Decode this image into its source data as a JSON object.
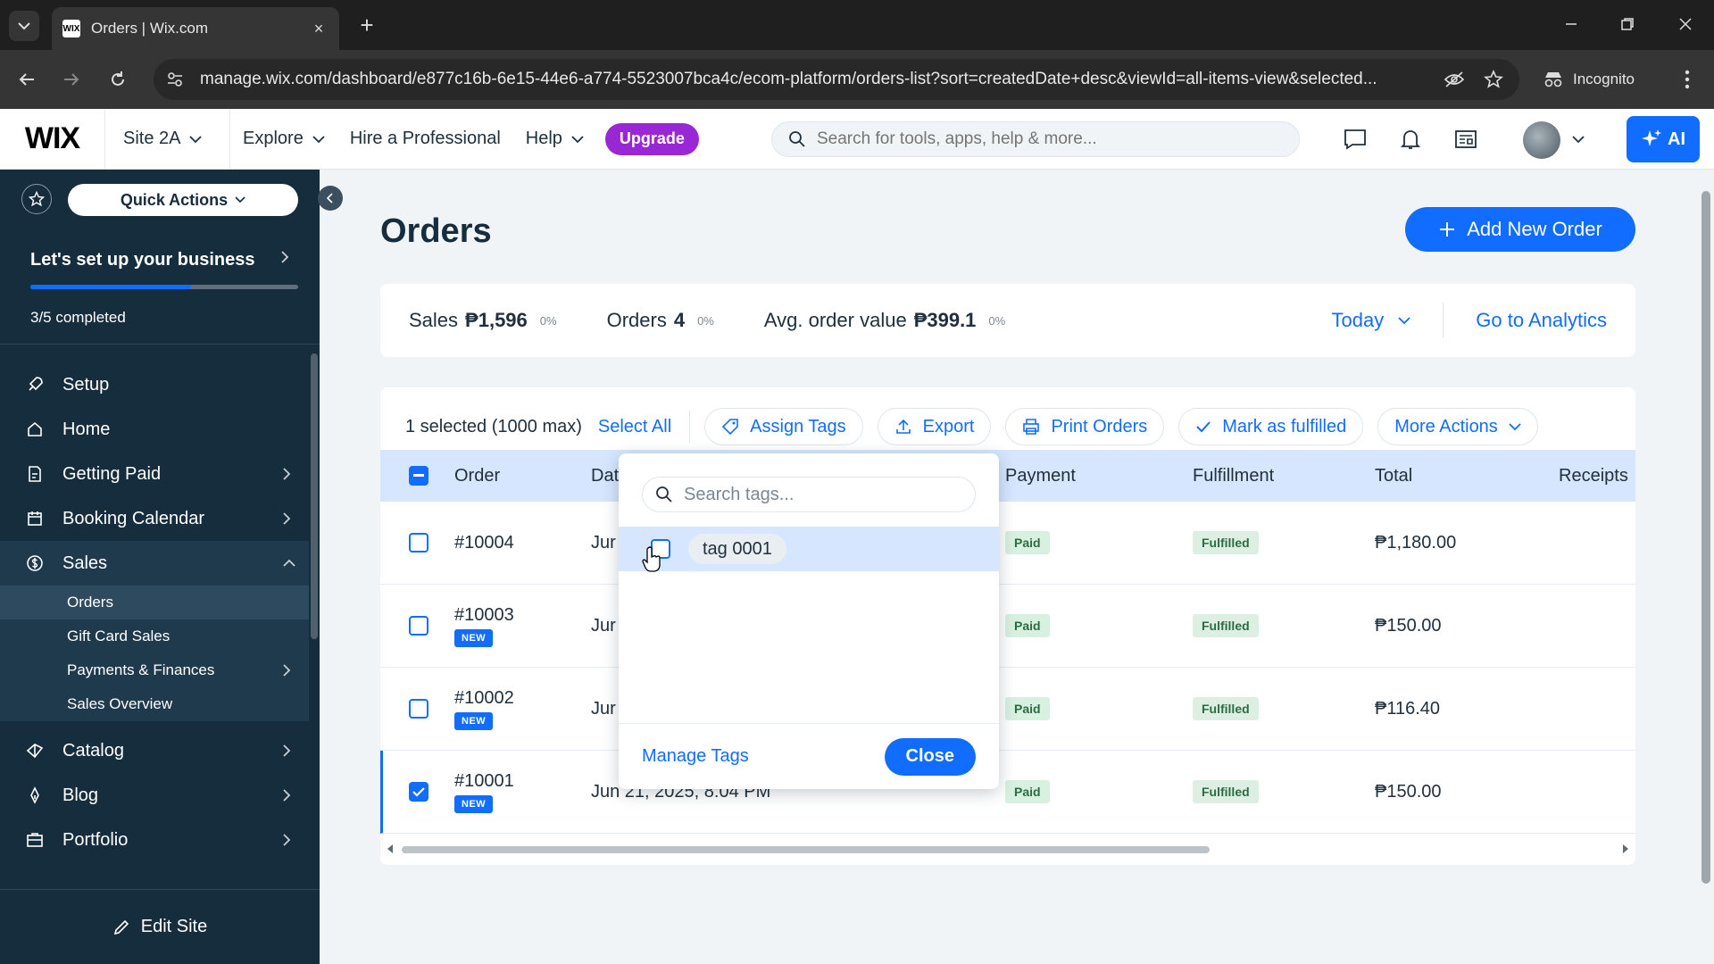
{
  "browser": {
    "tab_title": "Orders | Wix.com",
    "tab_favicon": "WIX",
    "url": "manage.wix.com/dashboard/e877c16b-6e15-44e6-a774-5523007bca4c/ecom-platform/orders-list?sort=createdDate+desc&viewId=all-items-view&selected...",
    "incognito_label": "Incognito",
    "new_tab": "+",
    "tab_close": "×"
  },
  "topbar": {
    "logo": "WIX",
    "site_name": "Site 2A",
    "nav": [
      "Explore",
      "Hire a Professional",
      "Help"
    ],
    "upgrade_label": "Upgrade",
    "search_placeholder": "Search for tools, apps, help & more...",
    "ai_label": "AI"
  },
  "sidebar": {
    "quick_actions": "Quick Actions",
    "setup_title": "Let's set up your business",
    "setup_progress_fraction": 0.6,
    "setup_completed": "3/5 completed",
    "items": [
      {
        "label": "Setup",
        "icon": "rocket-icon"
      },
      {
        "label": "Home",
        "icon": "home-icon"
      },
      {
        "label": "Getting Paid",
        "icon": "payment-icon"
      },
      {
        "label": "Booking Calendar",
        "icon": "calendar-icon"
      },
      {
        "label": "Sales",
        "icon": "dollar-icon"
      },
      {
        "label": "Catalog",
        "icon": "catalog-icon"
      },
      {
        "label": "Blog",
        "icon": "blog-icon"
      },
      {
        "label": "Portfolio",
        "icon": "portfolio-icon"
      }
    ],
    "sales_subitems": [
      "Orders",
      "Gift Card Sales",
      "Payments & Finances",
      "Sales Overview"
    ],
    "edit_site": "Edit Site"
  },
  "main": {
    "title": "Orders",
    "add_order": "Add New Order",
    "stats": {
      "sales_label": "Sales",
      "sales_value": "₱1,596",
      "sales_pct": "0%",
      "orders_label": "Orders",
      "orders_value": "4",
      "orders_pct": "0%",
      "avg_label": "Avg. order value",
      "avg_value": "₱399.1",
      "avg_pct": "0%",
      "period": "Today",
      "analytics_link": "Go to Analytics"
    },
    "bulk": {
      "selected_text": "1 selected (1000 max)",
      "select_all": "Select All",
      "actions": [
        "Assign Tags",
        "Export",
        "Print Orders",
        "Mark as fulfilled",
        "More Actions"
      ]
    },
    "columns": [
      "Order",
      "Dat",
      "Payment",
      "Fulfillment",
      "Total",
      "Receipts"
    ],
    "rows": [
      {
        "order": "#10004",
        "date": "Jur",
        "new": "",
        "payment": "Paid",
        "fulfillment": "Fulfilled",
        "total": "₱1,180.00",
        "checked": false
      },
      {
        "order": "#10003",
        "date": "Jur",
        "new": "NEW",
        "payment": "Paid",
        "fulfillment": "Fulfilled",
        "total": "₱150.00",
        "checked": false
      },
      {
        "order": "#10002",
        "date": "Jur",
        "new": "NEW",
        "payment": "Paid",
        "fulfillment": "Fulfilled",
        "total": "₱116.40",
        "checked": false
      },
      {
        "order": "#10001",
        "date": "Jun 21, 2025, 8:04 PM",
        "new": "NEW",
        "payment": "Paid",
        "fulfillment": "Fulfilled",
        "total": "₱150.00",
        "checked": true
      }
    ]
  },
  "tag_popover": {
    "search_placeholder": "Search tags...",
    "tags": [
      "tag 0001"
    ],
    "manage_tags": "Manage Tags",
    "close": "Close"
  },
  "colors": {
    "accent": "#116dff",
    "sidebar_bg": "#162d3d",
    "upgrade": "#9a27d5",
    "header_row": "#d6e6fe"
  }
}
